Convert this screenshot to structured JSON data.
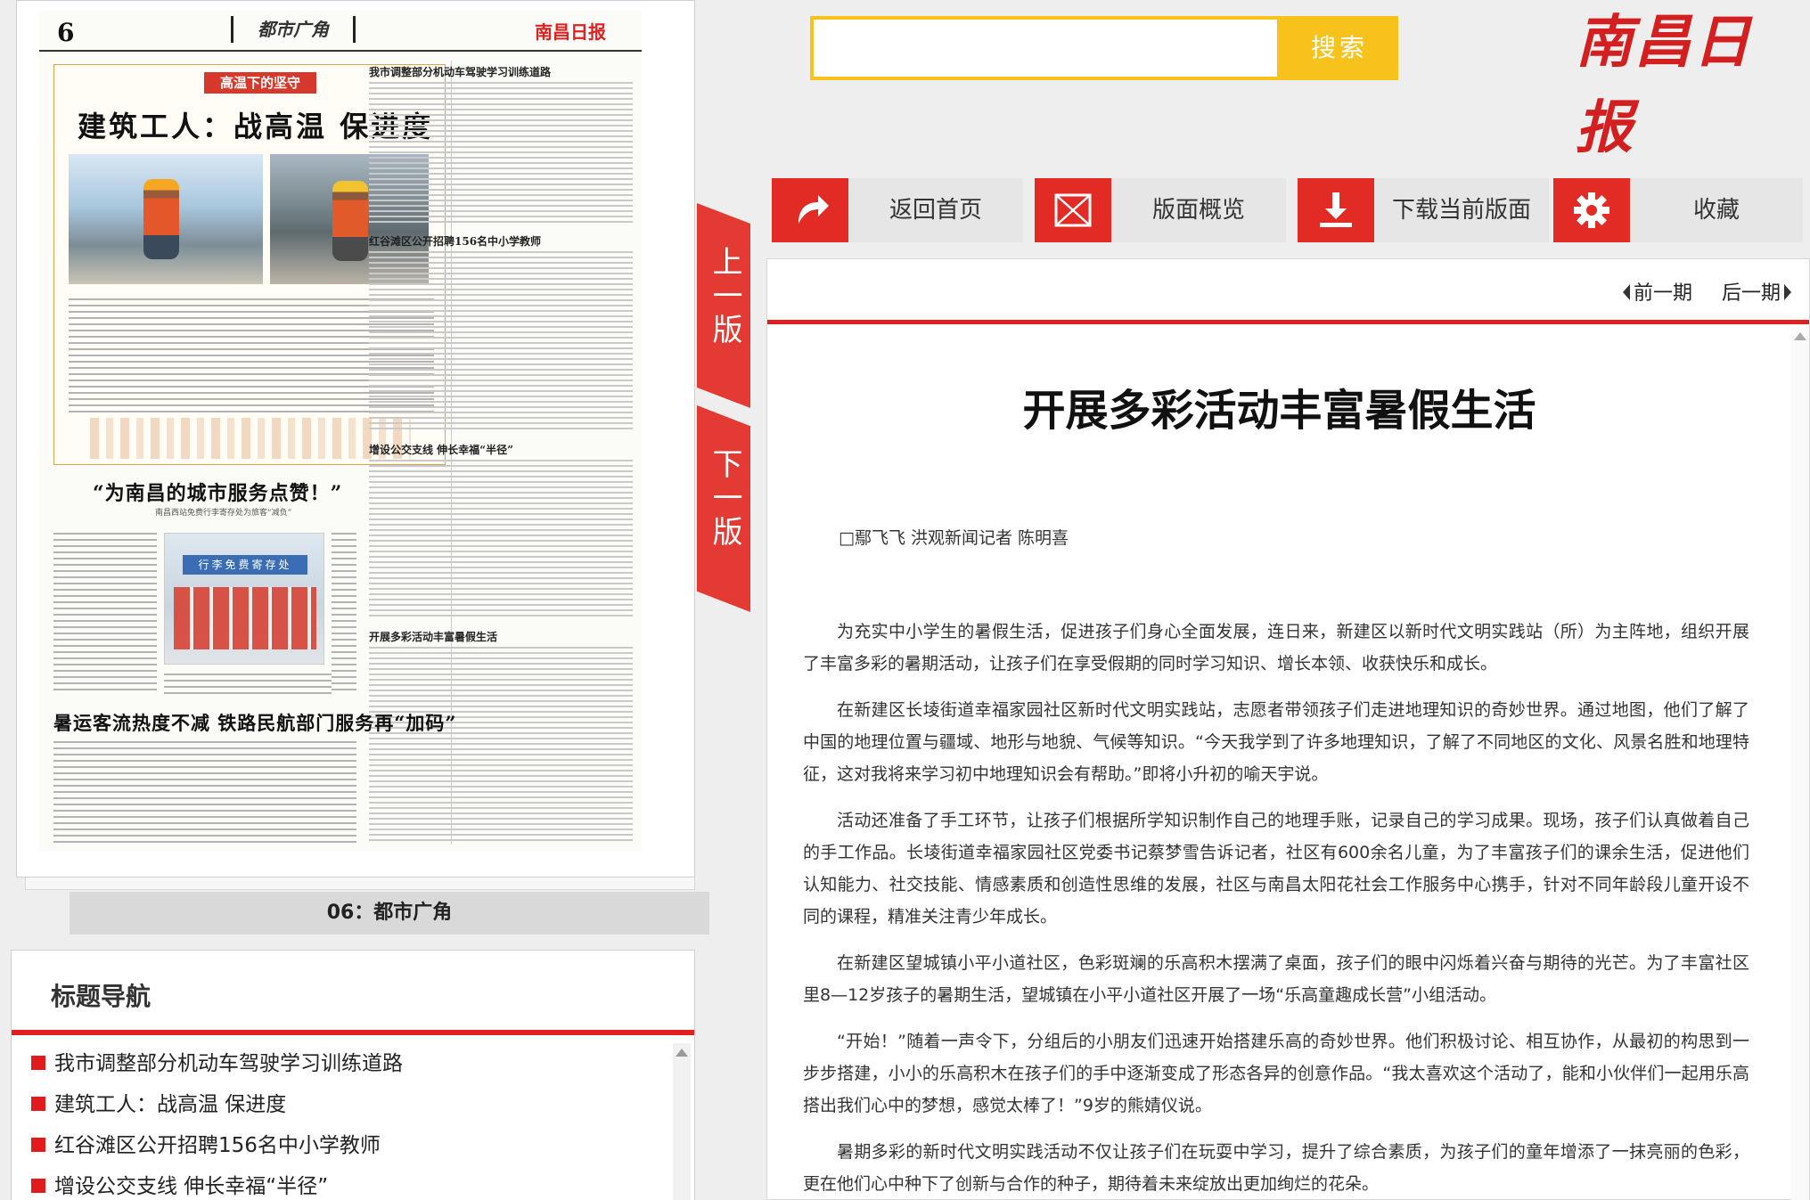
{
  "search": {
    "placeholder": "",
    "button_label": "搜索"
  },
  "logo": "南昌日报",
  "toolbar": {
    "home": "返回首页",
    "overview": "版面概览",
    "download": "下载当前版面",
    "favorite": "收藏"
  },
  "page_nav": {
    "prev_page": "上一版",
    "next_page": "下一版"
  },
  "page_caption": "06：都市广角",
  "paper_thumb": {
    "page_number": "6",
    "section": "都市广角",
    "masthead_logo": "南昌日报",
    "lead_kicker": "高温下的坚守",
    "lead_title": "建筑工人：战高温 保进度",
    "right_heads": [
      "我市调整部分机动车驾驶学习训练道路",
      "红谷滩区公开招聘156名中小学教师",
      "增设公交支线 伸长幸福“半径”",
      "开展多彩活动丰富暑假生活"
    ],
    "mid_headline": "“为南昌的城市服务点赞！”",
    "mid_sub": "南昌西站免费行李寄存处为旅客“减负”",
    "photo_sign": "行李免费寄存处",
    "bottom_headline": "暑运客流热度不减 铁路民航部门服务再“加码”"
  },
  "title_nav": {
    "heading": "标题导航",
    "items": [
      "我市调整部分机动车驾驶学习训练道路",
      "建筑工人：战高温 保进度",
      "红谷滩区公开招聘156名中小学教师",
      "增设公交支线 伸长幸福“半径”"
    ]
  },
  "issue_nav": {
    "prev": "前一期",
    "next": "后一期"
  },
  "article": {
    "title": "开展多彩活动丰富暑假生活",
    "byline": "□鄢飞飞 洪观新闻记者 陈明喜",
    "paragraphs": [
      "为充实中小学生的暑假生活，促进孩子们身心全面发展，连日来，新建区以新时代文明实践站（所）为主阵地，组织开展了丰富多彩的暑期活动，让孩子们在享受假期的同时学习知识、增长本领、收获快乐和成长。",
      "在新建区长堎街道幸福家园社区新时代文明实践站，志愿者带领孩子们走进地理知识的奇妙世界。通过地图，他们了解了中国的地理位置与疆域、地形与地貌、气候等知识。“今天我学到了许多地理知识，了解了不同地区的文化、风景名胜和地理特征，这对我将来学习初中地理知识会有帮助。”即将小升初的喻天宇说。",
      "活动还准备了手工环节，让孩子们根据所学知识制作自己的地理手账，记录自己的学习成果。现场，孩子们认真做着自己的手工作品。长堎街道幸福家园社区党委书记蔡梦雪告诉记者，社区有600余名儿童，为了丰富孩子们的课余生活，促进他们认知能力、社交技能、情感素质和创造性思维的发展，社区与南昌太阳花社会工作服务中心携手，针对不同年龄段儿童开设不同的课程，精准关注青少年成长。",
      "在新建区望城镇小平小道社区，色彩斑斓的乐高积木摆满了桌面，孩子们的眼中闪烁着兴奋与期待的光芒。为了丰富社区里8—12岁孩子的暑期生活，望城镇在小平小道社区开展了一场“乐高童趣成长营”小组活动。",
      "“开始！”随着一声令下，分组后的小朋友们迅速开始搭建乐高的奇妙世界。他们积极讨论、相互协作，从最初的构思到一步步搭建，小小的乐高积木在孩子们的手中逐渐变成了形态各异的创意作品。“我太喜欢这个活动了，能和小伙伴们一起用乐高搭出我们心中的梦想，感觉太棒了！”9岁的熊婧仪说。",
      "暑期多彩的新时代文明实践活动不仅让孩子们在玩耍中学习，提升了综合素质，为孩子们的童年增添了一抹亮丽的色彩，更在他们心中种下了创新与合作的种子，期待着未来绽放出更加绚烂的花朵。"
    ]
  },
  "colors": {
    "accent_red": "#e22b25",
    "search_yellow": "#f7c21b",
    "logo_red": "#d31f1f"
  }
}
